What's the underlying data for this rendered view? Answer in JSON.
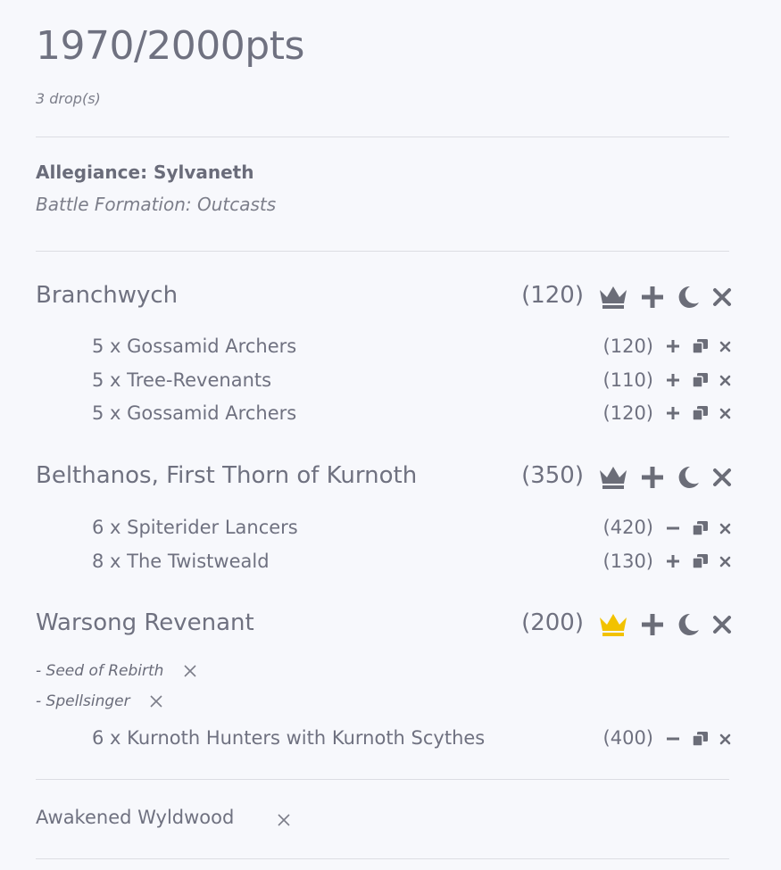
{
  "header": {
    "points_total": "1970/2000pts",
    "drops": "3 drop(s)"
  },
  "army": {
    "allegiance": "Allegiance: Sylvaneth",
    "battle_formation": "Battle Formation:  Outcasts"
  },
  "regiments": [
    {
      "leader": "Branchwych",
      "points": "(120)",
      "general": false,
      "units": [
        {
          "label": "5 x Gossamid Archers",
          "points": "(120)",
          "action": "plus"
        },
        {
          "label": "5 x Tree-Revenants",
          "points": "(110)",
          "action": "plus"
        },
        {
          "label": "5 x Gossamid Archers",
          "points": "(120)",
          "action": "plus"
        }
      ],
      "enhancements": []
    },
    {
      "leader": "Belthanos, First Thorn of Kurnoth",
      "points": "(350)",
      "general": false,
      "units": [
        {
          "label": "6 x Spiterider Lancers",
          "points": "(420)",
          "action": "minus"
        },
        {
          "label": "8 x The Twistweald",
          "points": "(130)",
          "action": "plus"
        }
      ],
      "enhancements": []
    },
    {
      "leader": "Warsong Revenant",
      "points": "(200)",
      "general": true,
      "units": [
        {
          "label": "6 x Kurnoth Hunters with Kurnoth Scythes",
          "points": "(400)",
          "action": "minus"
        }
      ],
      "enhancements": [
        "- Seed of Rebirth",
        "- Spellsinger"
      ]
    }
  ],
  "terrain": {
    "label": "Awakened Wyldwood"
  },
  "colors": {
    "text": "#6f7180",
    "icon": "#6b6d78",
    "general_active": "#f2c200",
    "divider": "#dcdde3"
  }
}
